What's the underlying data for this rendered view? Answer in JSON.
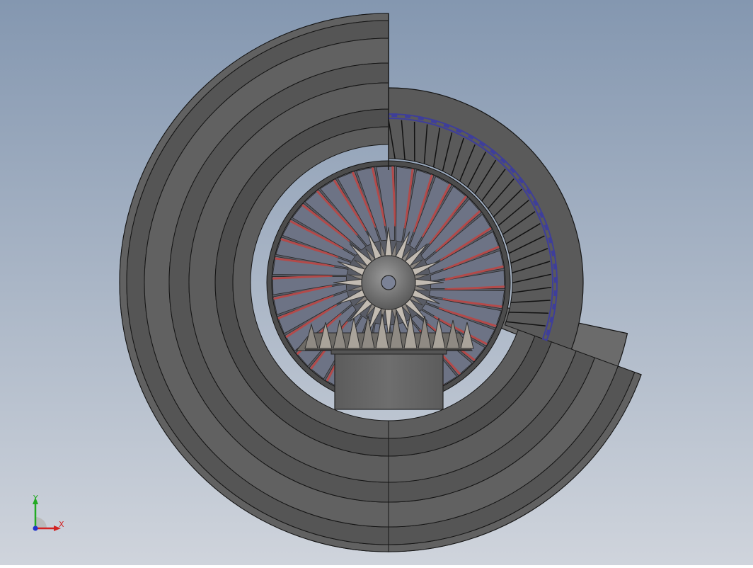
{
  "viewport": {
    "background_top": "#8497b0",
    "background_bottom": "#cfd4dc",
    "model": {
      "shell_color": "#5a5a5a",
      "shell_light": "#6b6b6b",
      "edge_color": "#151515",
      "blade_color": "#6d7385",
      "blade_edge_red": "#b34a4a",
      "seal_blue": "#3e3e9a",
      "gear_color": "#8a8580",
      "gear_light": "#c2bbb2",
      "hub_color": "#6a6a6a",
      "rotor_blade_count": 36,
      "outer_blade_count": 24,
      "gear_tooth_count": 16
    }
  },
  "triad": {
    "x_label": "X",
    "y_label": "Y",
    "x_color": "#d22222",
    "y_color": "#22aa22",
    "z_color": "#2233cc"
  }
}
